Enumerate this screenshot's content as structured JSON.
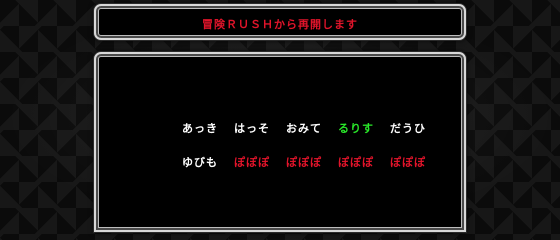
{
  "title": "冒険ＲＵＳＨから再開します",
  "colors": {
    "white": "#ffffff",
    "green": "#29e629",
    "red": "#e0142a"
  },
  "password": {
    "row1": [
      {
        "text": "あっき",
        "color": "white"
      },
      {
        "text": "はっそ",
        "color": "white"
      },
      {
        "text": "おみて",
        "color": "white"
      },
      {
        "text": "るりす",
        "color": "green"
      },
      {
        "text": "だうひ",
        "color": "white"
      }
    ],
    "row2": [
      {
        "text": "ゆびも",
        "color": "white"
      },
      {
        "text": "ぽぽぽ",
        "color": "red"
      },
      {
        "text": "ぽぽぽ",
        "color": "red"
      },
      {
        "text": "ぽぽぽ",
        "color": "red"
      },
      {
        "text": "ぽぽぽ",
        "color": "red"
      }
    ]
  }
}
